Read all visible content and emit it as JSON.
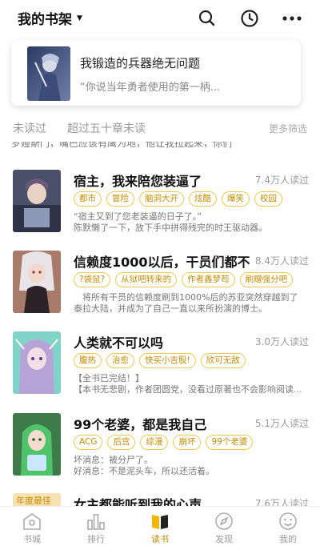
{
  "header": {
    "title": "我的书架",
    "icons": [
      "search-icon",
      "history-clock-icon",
      "more-icon"
    ]
  },
  "featured": {
    "title": "我锻造的兵器绝无问题",
    "subtitle": "“你说当年勇者使用的第一柄..."
  },
  "filters": {
    "tabs": [
      "未读过",
      "超过五十章未读"
    ],
    "more": "更多筛选"
  },
  "cut_off_text": "罗娅斯门，嘴巴应该有鹰为地，他让我拉起来，你们",
  "books": [
    {
      "title": "宿主，我来陪您装逼了",
      "reads": "7.4万人读过",
      "tags": [
        "都市",
        "冒险",
        "脑洞大开",
        "炫酷",
        "爆笑",
        "校园"
      ],
      "desc": [
        "“宿主又到了您老装逼的日子了。”",
        "陈默懒了一下，放下手中拼得残完的时王驱动器。"
      ]
    },
    {
      "title": "信赖度1000以后，干员们都不...",
      "reads": "8.4万人读过",
      "tags": [
        "?袋鼠?",
        "从狱吧转来的",
        "作者鑫梦苟",
        "刷赠强分吧"
      ],
      "desc": [
        "　将所有干员的信赖度刷到1000%后的苏亚突然穿越到了",
        "泰拉大陆，并成为了自己一直以来所扮演的博士。"
      ]
    },
    {
      "title": "人类就不可以吗",
      "reads": "3.0万人读过",
      "tags": [
        "腹热",
        "治愈",
        "快买小吉股!",
        "欣可无敌"
      ],
      "desc": [
        "【全书已完结！】",
        "【本书无悲剧，作者团圆党，没看过原著也不会影响阅读..."
      ]
    },
    {
      "title": "99个老婆，都是我自己",
      "reads": "5.1万人读过",
      "tags": [
        "ACG",
        "后宫",
        "综漫",
        "崩坏",
        "99个老婆"
      ],
      "desc": [
        "坏消息：被分尸了。",
        "好消息：不是泥头车，所以还活着。"
      ]
    },
    {
      "title": "女主都能听到我的心声",
      "reads": "7.6万人读过",
      "badge": "年度最佳",
      "tags": [],
      "desc": []
    }
  ],
  "nav": {
    "items": [
      {
        "label": "书城",
        "icon": "bookstore-icon"
      },
      {
        "label": "排行",
        "icon": "ranking-icon"
      },
      {
        "label": "读书",
        "icon": "read-book-icon"
      },
      {
        "label": "发现",
        "icon": "compass-icon"
      },
      {
        "label": "我的",
        "icon": "profile-icon"
      }
    ],
    "active_index": 2,
    "accent_color": "#f2b705"
  },
  "colors": {
    "accent": "#f2c94c",
    "tag_text": "#c48d00",
    "muted": "#999999"
  }
}
